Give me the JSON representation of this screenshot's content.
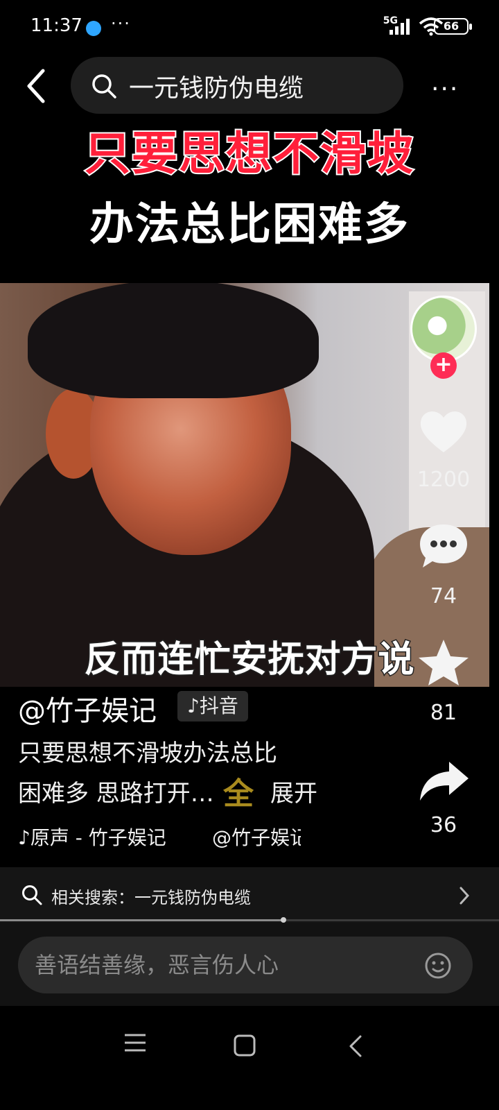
{
  "status_bar": {
    "time": "11:37",
    "more": "···",
    "network": "5G",
    "battery": "66"
  },
  "search": {
    "query": "一元钱防伪电缆",
    "more": "···"
  },
  "banner": {
    "line1": "只要思想不滑坡",
    "line2": "办法总比困难多"
  },
  "video": {
    "caption": "反而连忙安抚对方说"
  },
  "actions": {
    "likes": "1200",
    "comments": "74",
    "favorites": "81",
    "shares": "36"
  },
  "post": {
    "author": "@竹子娱记",
    "platform_tag": "抖音",
    "description_line1": "只要思想不滑坡办法总比",
    "description_line2": "困难多 思路打开…",
    "unfold_label": "全",
    "unfold_suffix": "展开",
    "music": "♪原声 - 竹子娱记",
    "mention": "@竹子娱记"
  },
  "related": {
    "text": "相关搜索：一元钱防伪电缆"
  },
  "playback": {
    "progress": 0.58
  },
  "comment": {
    "placeholder": "善语结善缘，恶言伤人心"
  },
  "colors": {
    "accent": "#fe2c55",
    "headline_red": "#ff1f3a",
    "unfold_gold": "#a98b1e"
  }
}
